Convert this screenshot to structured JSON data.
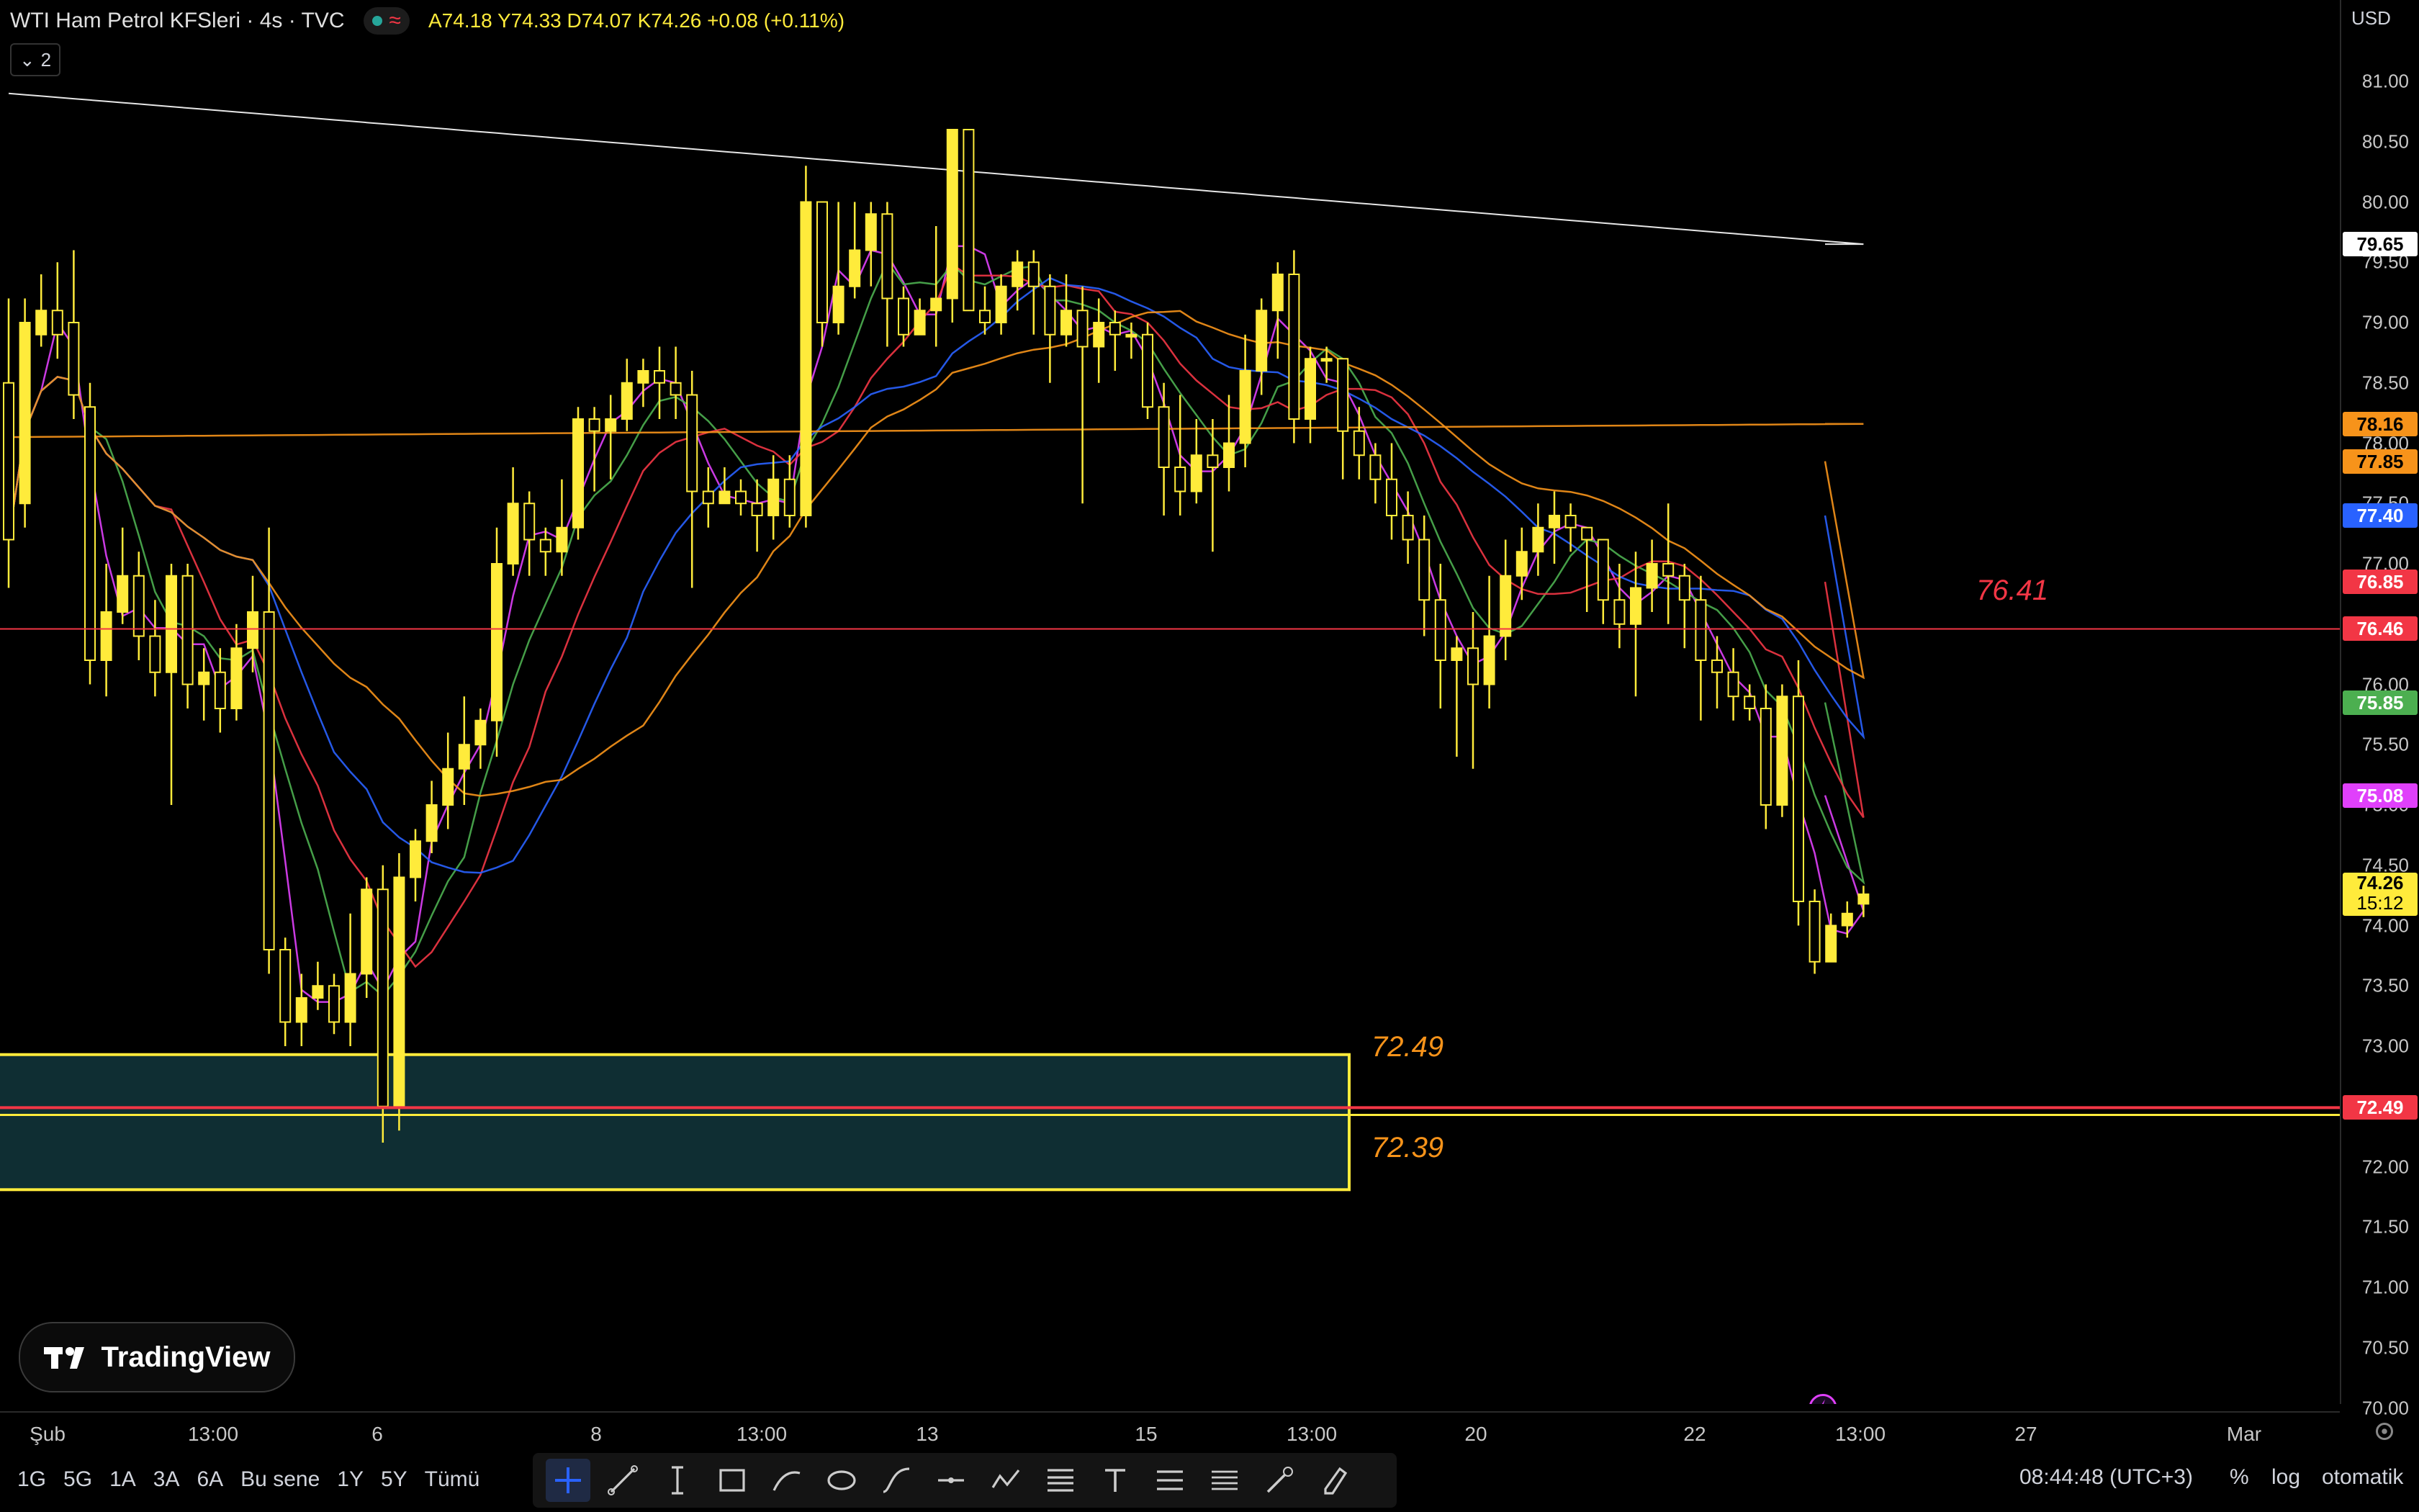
{
  "header": {
    "title": "WTI Ham Petrol KFSleri · 4s · TVC",
    "ohlc": "A74.18 Y74.33 D74.07 K74.26 +0.08 (+0.11%)",
    "legend_count": "2"
  },
  "price_axis": {
    "currency": "USD",
    "ticks": [
      "81.00",
      "80.50",
      "80.00",
      "79.50",
      "79.00",
      "78.50",
      "78.00",
      "77.50",
      "77.00",
      "76.50",
      "76.00",
      "75.50",
      "75.00",
      "74.50",
      "74.00",
      "73.50",
      "73.00",
      "72.50",
      "72.00",
      "71.50",
      "71.00",
      "70.50",
      "70.00"
    ],
    "badges": [
      {
        "value": "79.65",
        "color": "#ffffff",
        "text_color": "#000000"
      },
      {
        "value": "78.16",
        "color": "#f7931a",
        "text_color": "#000000"
      },
      {
        "value": "77.85",
        "color": "#f7931a",
        "text_color": "#000000"
      },
      {
        "value": "77.40",
        "color": "#2962ff",
        "text_color": "#ffffff"
      },
      {
        "value": "76.85",
        "color": "#f23645",
        "text_color": "#ffffff"
      },
      {
        "value": "76.46",
        "color": "#f23645",
        "text_color": "#ffffff"
      },
      {
        "value": "75.85",
        "color": "#4caf50",
        "text_color": "#ffffff"
      },
      {
        "value": "75.08",
        "color": "#e040fb",
        "text_color": "#ffffff"
      },
      {
        "value": "74.26",
        "color": "#ffeb3b",
        "text_color": "#000000",
        "sub": "15:12"
      },
      {
        "value": "72.49",
        "color": "#f23645",
        "text_color": "#ffffff"
      }
    ]
  },
  "time_axis": {
    "labels": [
      "Şub",
      "13:00",
      "6",
      "8",
      "13:00",
      "13",
      "15",
      "13:00",
      "20",
      "22",
      "13:00",
      "27",
      "Mar"
    ]
  },
  "drawings": {
    "zone_top_label": "72.49",
    "zone_bottom_label": "72.39",
    "resistance_label": "76.41"
  },
  "bottom_bar": {
    "periods": [
      "1G",
      "5G",
      "1A",
      "3A",
      "6A",
      "Bu sene",
      "1Y",
      "5Y",
      "Tümü"
    ],
    "clock": "08:44:48 (UTC+3)",
    "percent": "%",
    "log": "log",
    "auto": "otomatik"
  },
  "logo_text": "TradingView",
  "colors": {
    "candle": "#ffeb3b",
    "zone_fill": "#0f2e33",
    "zone_border": "#ffeb3b",
    "hline": "#f23645",
    "purple_line": "#e040fb"
  },
  "chart_data": {
    "type": "candlestick",
    "ylim": [
      70.0,
      81.0
    ],
    "candles": [
      [
        78.5,
        77.2,
        79.2,
        76.8
      ],
      [
        77.5,
        79.0,
        79.2,
        77.3
      ],
      [
        78.9,
        79.1,
        79.4,
        78.8
      ],
      [
        79.1,
        78.9,
        79.5,
        78.7
      ],
      [
        79.0,
        78.4,
        79.6,
        78.2
      ],
      [
        78.3,
        76.2,
        78.5,
        76.0
      ],
      [
        76.2,
        76.6,
        77.0,
        75.9
      ],
      [
        76.6,
        76.9,
        77.3,
        76.5
      ],
      [
        76.9,
        76.4,
        77.1,
        76.2
      ],
      [
        76.4,
        76.1,
        76.7,
        75.9
      ],
      [
        76.1,
        76.9,
        77.0,
        75.0
      ],
      [
        76.9,
        76.0,
        77.0,
        75.8
      ],
      [
        76.0,
        76.1,
        76.3,
        75.7
      ],
      [
        76.1,
        75.8,
        76.3,
        75.6
      ],
      [
        75.8,
        76.3,
        76.5,
        75.7
      ],
      [
        76.3,
        76.6,
        76.9,
        76.1
      ],
      [
        76.6,
        73.8,
        77.3,
        73.6
      ],
      [
        73.8,
        73.2,
        73.9,
        73.0
      ],
      [
        73.2,
        73.4,
        73.6,
        73.0
      ],
      [
        73.4,
        73.5,
        73.7,
        73.3
      ],
      [
        73.5,
        73.2,
        73.6,
        73.1
      ],
      [
        73.2,
        73.6,
        74.1,
        73.0
      ],
      [
        73.6,
        74.3,
        74.4,
        73.4
      ],
      [
        74.3,
        72.5,
        74.5,
        72.2
      ],
      [
        72.5,
        74.4,
        74.6,
        72.3
      ],
      [
        74.4,
        74.7,
        74.8,
        74.2
      ],
      [
        74.7,
        75.0,
        75.2,
        74.6
      ],
      [
        75.0,
        75.3,
        75.6,
        74.8
      ],
      [
        75.3,
        75.5,
        75.9,
        75.0
      ],
      [
        75.5,
        75.7,
        75.8,
        75.3
      ],
      [
        75.7,
        77.0,
        77.3,
        75.4
      ],
      [
        77.0,
        77.5,
        77.8,
        76.9
      ],
      [
        77.5,
        77.2,
        77.6,
        76.9
      ],
      [
        77.2,
        77.1,
        77.3,
        76.9
      ],
      [
        77.1,
        77.3,
        77.7,
        76.9
      ],
      [
        77.3,
        78.2,
        78.3,
        77.2
      ],
      [
        78.2,
        78.1,
        78.3,
        77.6
      ],
      [
        78.1,
        78.2,
        78.4,
        77.7
      ],
      [
        78.2,
        78.5,
        78.7,
        78.1
      ],
      [
        78.5,
        78.6,
        78.7,
        78.3
      ],
      [
        78.6,
        78.5,
        78.8,
        78.2
      ],
      [
        78.5,
        78.4,
        78.8,
        78.2
      ],
      [
        78.4,
        77.6,
        78.6,
        76.8
      ],
      [
        77.6,
        77.5,
        77.8,
        77.3
      ],
      [
        77.5,
        77.6,
        77.8,
        77.5
      ],
      [
        77.6,
        77.5,
        77.7,
        77.4
      ],
      [
        77.5,
        77.4,
        77.7,
        77.1
      ],
      [
        77.4,
        77.7,
        77.9,
        77.2
      ],
      [
        77.7,
        77.4,
        77.9,
        77.3
      ],
      [
        77.4,
        80.0,
        80.3,
        77.3
      ],
      [
        80.0,
        79.0,
        80.0,
        78.8
      ],
      [
        79.0,
        79.3,
        80.0,
        78.9
      ],
      [
        79.3,
        79.6,
        80.0,
        79.2
      ],
      [
        79.6,
        79.9,
        80.0,
        79.3
      ],
      [
        79.9,
        79.2,
        80.0,
        78.8
      ],
      [
        79.2,
        78.9,
        79.3,
        78.8
      ],
      [
        78.9,
        79.1,
        79.2,
        78.9
      ],
      [
        79.1,
        79.2,
        79.8,
        78.8
      ],
      [
        79.2,
        80.6,
        80.6,
        79.0
      ],
      [
        80.6,
        79.1,
        80.6,
        79.1
      ],
      [
        79.1,
        79.0,
        79.3,
        78.9
      ],
      [
        79.0,
        79.3,
        79.4,
        78.9
      ],
      [
        79.3,
        79.5,
        79.6,
        79.1
      ],
      [
        79.5,
        79.3,
        79.6,
        78.9
      ],
      [
        79.3,
        78.9,
        79.4,
        78.5
      ],
      [
        78.9,
        79.1,
        79.4,
        78.8
      ],
      [
        79.1,
        78.8,
        79.3,
        77.5
      ],
      [
        78.8,
        79.0,
        79.2,
        78.5
      ],
      [
        79.0,
        78.9,
        79.1,
        78.6
      ],
      [
        78.9,
        78.9,
        79.0,
        78.7
      ],
      [
        78.9,
        78.3,
        79.0,
        78.2
      ],
      [
        78.3,
        77.8,
        78.5,
        77.4
      ],
      [
        77.8,
        77.6,
        78.4,
        77.4
      ],
      [
        77.6,
        77.9,
        78.2,
        77.5
      ],
      [
        77.9,
        77.8,
        78.2,
        77.1
      ],
      [
        77.8,
        78.0,
        78.4,
        77.6
      ],
      [
        78.0,
        78.6,
        78.9,
        77.8
      ],
      [
        78.6,
        79.1,
        79.2,
        78.4
      ],
      [
        79.1,
        79.4,
        79.5,
        78.7
      ],
      [
        79.4,
        78.2,
        79.6,
        78.0
      ],
      [
        78.2,
        78.7,
        78.8,
        78.0
      ],
      [
        78.7,
        78.7,
        78.8,
        78.5
      ],
      [
        78.7,
        78.1,
        78.7,
        77.7
      ],
      [
        78.1,
        77.9,
        78.3,
        77.7
      ],
      [
        77.9,
        77.7,
        78.0,
        77.5
      ],
      [
        77.7,
        77.4,
        78.0,
        77.2
      ],
      [
        77.4,
        77.2,
        77.6,
        77.0
      ],
      [
        77.2,
        76.7,
        77.4,
        76.4
      ],
      [
        76.7,
        76.2,
        77.0,
        75.8
      ],
      [
        76.2,
        76.3,
        76.4,
        75.4
      ],
      [
        76.3,
        76.0,
        76.6,
        75.3
      ],
      [
        76.0,
        76.4,
        76.9,
        75.8
      ],
      [
        76.4,
        76.9,
        77.2,
        76.2
      ],
      [
        76.9,
        77.1,
        77.3,
        76.7
      ],
      [
        77.1,
        77.3,
        77.5,
        76.9
      ],
      [
        77.3,
        77.4,
        77.6,
        77.0
      ],
      [
        77.4,
        77.3,
        77.5,
        77.1
      ],
      [
        77.3,
        77.2,
        77.3,
        76.6
      ],
      [
        77.2,
        76.7,
        77.2,
        76.5
      ],
      [
        76.7,
        76.5,
        77.0,
        76.3
      ],
      [
        76.5,
        76.8,
        77.1,
        75.9
      ],
      [
        76.8,
        77.0,
        77.2,
        76.6
      ],
      [
        77.0,
        76.9,
        77.5,
        76.5
      ],
      [
        76.9,
        76.7,
        77.0,
        76.3
      ],
      [
        76.7,
        76.2,
        76.9,
        75.7
      ],
      [
        76.2,
        76.1,
        76.4,
        75.8
      ],
      [
        76.1,
        75.9,
        76.3,
        75.7
      ],
      [
        75.9,
        75.8,
        76.0,
        75.7
      ],
      [
        75.8,
        75.0,
        76.0,
        74.8
      ],
      [
        75.0,
        75.9,
        76.0,
        74.9
      ],
      [
        75.9,
        74.2,
        76.2,
        74.0
      ],
      [
        74.2,
        73.7,
        74.3,
        73.6
      ],
      [
        73.7,
        74.0,
        74.1,
        73.7
      ],
      [
        74.0,
        74.1,
        74.2,
        73.9
      ],
      [
        74.18,
        74.26,
        74.33,
        74.07
      ]
    ],
    "moving_averages": [
      {
        "color": "#e040fb",
        "last": 75.08
      },
      {
        "color": "#4caf50",
        "last": 75.85
      },
      {
        "color": "#f23645",
        "last": 76.85
      },
      {
        "color": "#2962ff",
        "last": 77.4
      },
      {
        "color": "#f7931a",
        "last": 77.85
      },
      {
        "color": "#f7931a",
        "last": 78.16
      },
      {
        "color": "#ffffff",
        "last": 79.65
      }
    ]
  }
}
